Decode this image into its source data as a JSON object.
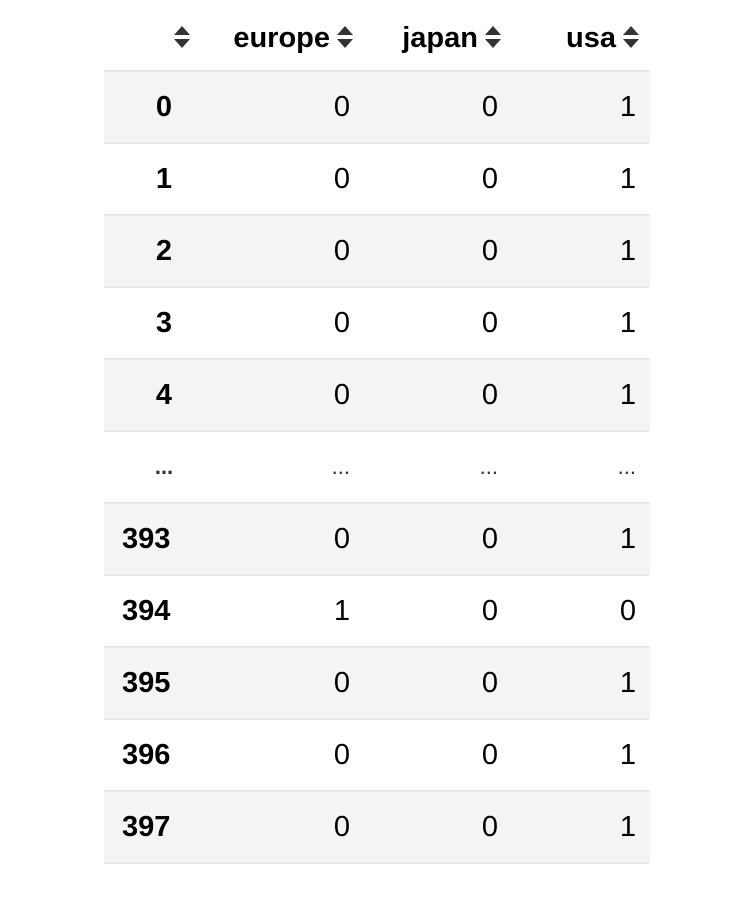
{
  "table": {
    "columns": [
      {
        "label": ""
      },
      {
        "label": "europe"
      },
      {
        "label": "japan"
      },
      {
        "label": "usa"
      }
    ],
    "rows": [
      {
        "index": "0",
        "europe": "0",
        "japan": "0",
        "usa": "1"
      },
      {
        "index": "1",
        "europe": "0",
        "japan": "0",
        "usa": "1"
      },
      {
        "index": "2",
        "europe": "0",
        "japan": "0",
        "usa": "1"
      },
      {
        "index": "3",
        "europe": "0",
        "japan": "0",
        "usa": "1"
      },
      {
        "index": "4",
        "europe": "0",
        "japan": "0",
        "usa": "1"
      },
      {
        "index": "...",
        "europe": "...",
        "japan": "...",
        "usa": "..."
      },
      {
        "index": "393",
        "europe": "0",
        "japan": "0",
        "usa": "1"
      },
      {
        "index": "394",
        "europe": "1",
        "japan": "0",
        "usa": "0"
      },
      {
        "index": "395",
        "europe": "0",
        "japan": "0",
        "usa": "1"
      },
      {
        "index": "396",
        "europe": "0",
        "japan": "0",
        "usa": "1"
      },
      {
        "index": "397",
        "europe": "0",
        "japan": "0",
        "usa": "1"
      }
    ]
  },
  "icons": {
    "sort": "sort-icon"
  },
  "colors": {
    "stripe": "#f4f4f4",
    "border": "#e6e6e6",
    "text": "#000000"
  }
}
